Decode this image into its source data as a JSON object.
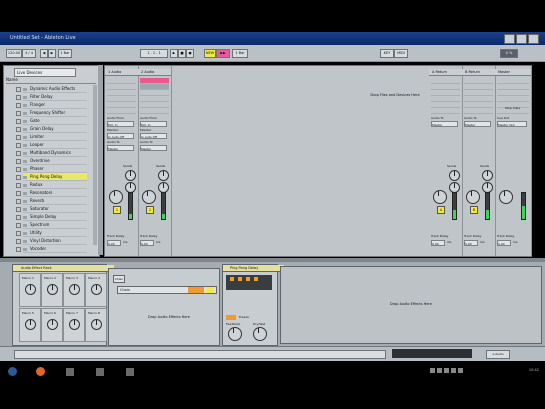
{
  "window": {
    "title": "Untitled Set - Ableton Live"
  },
  "toolbar": {
    "buttons": [
      "◀",
      "▶",
      "■",
      "●",
      "1 Bar",
      "NEW",
      "▶▶",
      "KEY",
      "MIDI"
    ],
    "bpm": "120.00",
    "sig": "4 / 4",
    "pos": "1 . 1 . 1",
    "cpu": "0 %"
  },
  "browser": {
    "folder_select": "Live Devices",
    "column_header": "Name",
    "items": [
      "Dynamic Audio Effects",
      "Filter Delay",
      "Flanger",
      "Frequency Shifter",
      "Gate",
      "Grain Delay",
      "Limiter",
      "Looper",
      "Multiband Dynamics",
      "Overdrive",
      "Phaser",
      "Ping Pong Delay",
      "Redux",
      "Resonators",
      "Reverb",
      "Saturator",
      "Simple Delay",
      "Spectrum",
      "Utility",
      "Vinyl Distortion",
      "Vocoder"
    ],
    "highlighted": "Ping Pong Delay"
  },
  "session": {
    "drop_message": "Drop Files and Devices Here",
    "tracks": [
      {
        "name": "1 Audio",
        "audio_from": "Audio From",
        "ext_in": "Ext. In",
        "monitor": "Monitor",
        "in_auto_off": "In  Auto  Off",
        "audio_to": "Audio To",
        "master": "Master",
        "number": "1",
        "sends_label": "Sends",
        "track_delay": "Track Delay",
        "delay_value": "0.00",
        "delay_unit": "ms",
        "meter": 0.2
      },
      {
        "name": "2 Audio",
        "audio_from": "Audio From",
        "ext_in": "Ext. In",
        "monitor": "Monitor",
        "in_auto_off": "In  Auto  Off",
        "audio_to": "Audio To",
        "master": "Master",
        "number": "2",
        "sends_label": "Sends",
        "track_delay": "Track Delay",
        "delay_value": "0.00",
        "delay_unit": "ms",
        "meter": 0.2
      },
      {
        "name": "A Return",
        "audio_to": "Audio To",
        "master": "Master",
        "number": "A",
        "sends_label": "Sends",
        "track_delay": "Track Delay",
        "delay_value": "0.00",
        "delay_unit": "ms",
        "meter": 0.35
      },
      {
        "name": "B Return",
        "audio_to": "Audio To",
        "master": "Master",
        "number": "B",
        "sends_label": "Sends",
        "track_delay": "Track Delay",
        "delay_value": "0.00",
        "delay_unit": "ms",
        "meter": 0.35
      },
      {
        "name": "Master",
        "cue_out": "Cue Out",
        "master_out": "Master Out",
        "number": "",
        "track_delay": "Track Delay",
        "delay_value": "0.00",
        "delay_unit": "ms",
        "stop_clips": "Stop Clips",
        "meter": 0.5
      }
    ]
  },
  "devices": {
    "rack_title": "Audio Effect Rack",
    "macros": [
      "Macro 1",
      "Macro 2",
      "Macro 3",
      "Macro 4",
      "Macro 5",
      "Macro 6",
      "Macro 7",
      "Macro 8"
    ],
    "chain_button": "Chain",
    "chain_name": "Chain",
    "chain_drop_msg": "Drop Audio Effects Here",
    "pingpong_title": "Ping Pong Delay",
    "pingpong_feedback": "Feedback",
    "pingpong_drywet": "Dry/Wet",
    "pingpong_freeze": "Freeze",
    "drop_fx_msg": "Drop Audio Effects Here"
  },
  "status": {
    "track_label": "1-Audio"
  },
  "taskbar": {
    "clock": "10:42"
  },
  "colors": {
    "yellow": "#f3e844",
    "pink": "#e85aa0",
    "orange": "#f29a2d",
    "meter_green": "#44d25a"
  }
}
